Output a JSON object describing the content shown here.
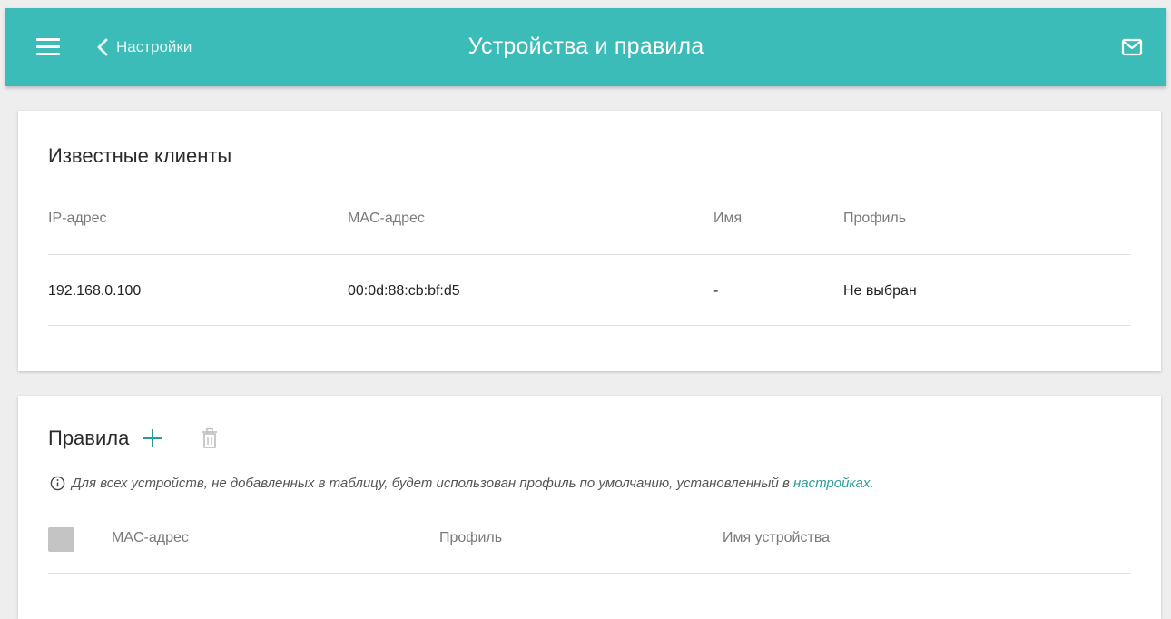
{
  "header": {
    "back_label": "Настройки",
    "title": "Устройства и правила",
    "accent_color": "#3bbcb8",
    "icons": [
      "menu-icon",
      "chevron-left-icon",
      "mail-icon"
    ]
  },
  "known_clients": {
    "title": "Известные клиенты",
    "columns": [
      "IP-адрес",
      "MAC-адрес",
      "Имя",
      "Профиль"
    ],
    "rows": [
      {
        "ip": "192.168.0.100",
        "mac": "00:0d:88:cb:bf:d5",
        "name": "-",
        "profile": "Не выбран"
      }
    ]
  },
  "rules": {
    "title": "Правила",
    "icons": [
      "plus-icon",
      "trash-icon",
      "info-icon"
    ],
    "hint_text": "Для всех устройств, не добавленных в таблицу, будет использован профиль по умолчанию, установленный в",
    "hint_link": "настройках",
    "hint_end": ".",
    "columns": [
      "MAC-адрес",
      "Профиль",
      "Имя устройства"
    ]
  }
}
